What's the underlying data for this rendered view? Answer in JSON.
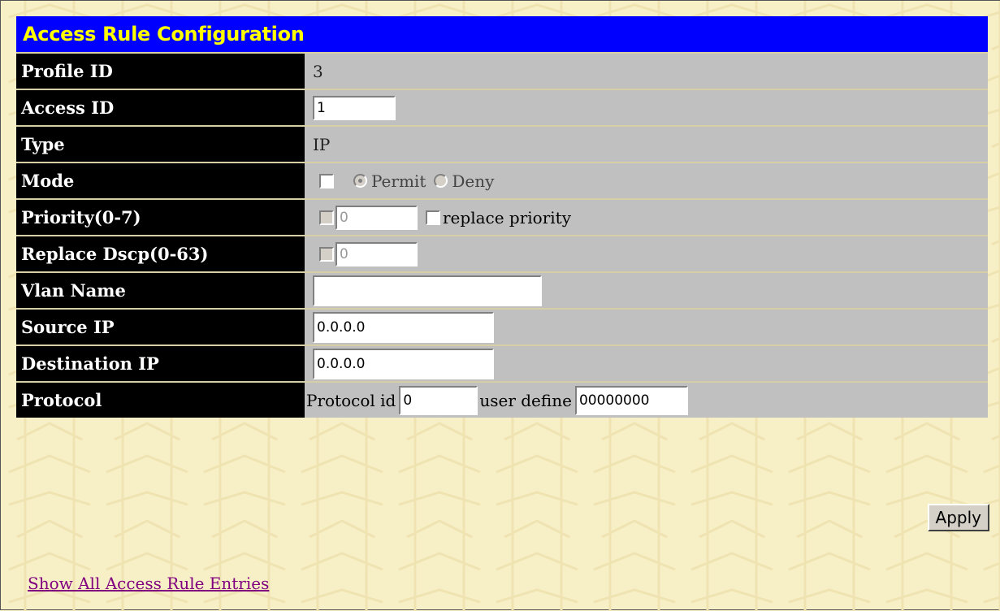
{
  "title": "Access Rule Configuration",
  "rows": {
    "profile_id": {
      "label": "Profile ID",
      "value": "3"
    },
    "access_id": {
      "label": "Access ID",
      "value": "1"
    },
    "type": {
      "label": "Type",
      "value": "IP"
    },
    "mode": {
      "label": "Mode",
      "permit_label": "Permit",
      "deny_label": "Deny",
      "selected": "Permit"
    },
    "priority": {
      "label": "Priority(0-7)",
      "value": "0",
      "replace_label": "replace priority"
    },
    "replace_dscp": {
      "label": "Replace Dscp(0-63)",
      "value": "0"
    },
    "vlan_name": {
      "label": "Vlan Name",
      "value": ""
    },
    "source_ip": {
      "label": "Source IP",
      "value": "0.0.0.0"
    },
    "destination_ip": {
      "label": "Destination IP",
      "value": "0.0.0.0"
    },
    "protocol": {
      "label": "Protocol",
      "protocol_id_label": "Protocol id",
      "protocol_id_value": "0",
      "user_define_label": "user define",
      "user_define_value": "00000000"
    }
  },
  "apply_label": "Apply",
  "link_text": "Show All Access Rule Entries",
  "colors": {
    "header_bg": "#0000ff",
    "header_text": "#ffff00",
    "label_bg": "#000000",
    "value_bg": "#c0c0c0",
    "page_bg": "#f7efc6",
    "link": "#800080"
  }
}
